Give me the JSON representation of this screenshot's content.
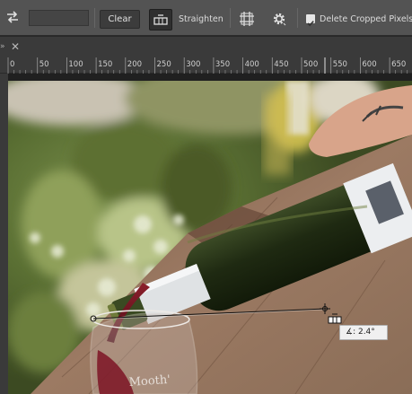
{
  "options_bar": {
    "clear_label": "Clear",
    "straighten_label": "Straighten",
    "delete_cropped_label": "Delete Cropped Pixels",
    "delete_cropped_checked": true,
    "ratio_value": ""
  },
  "tab_strip": {
    "arrows": "»",
    "close_glyph": "✕"
  },
  "ruler": {
    "ticks": [
      "0",
      "50",
      "100",
      "150",
      "200",
      "250",
      "300",
      "350",
      "400",
      "450",
      "500",
      "550",
      "600",
      "650"
    ]
  },
  "straighten_overlay": {
    "angle_label": "∡: 2.4°"
  },
  "colors": {
    "panel": "#535353",
    "tabstrip": "#3a3a3a",
    "accent_tool": "#2f2f2f"
  }
}
